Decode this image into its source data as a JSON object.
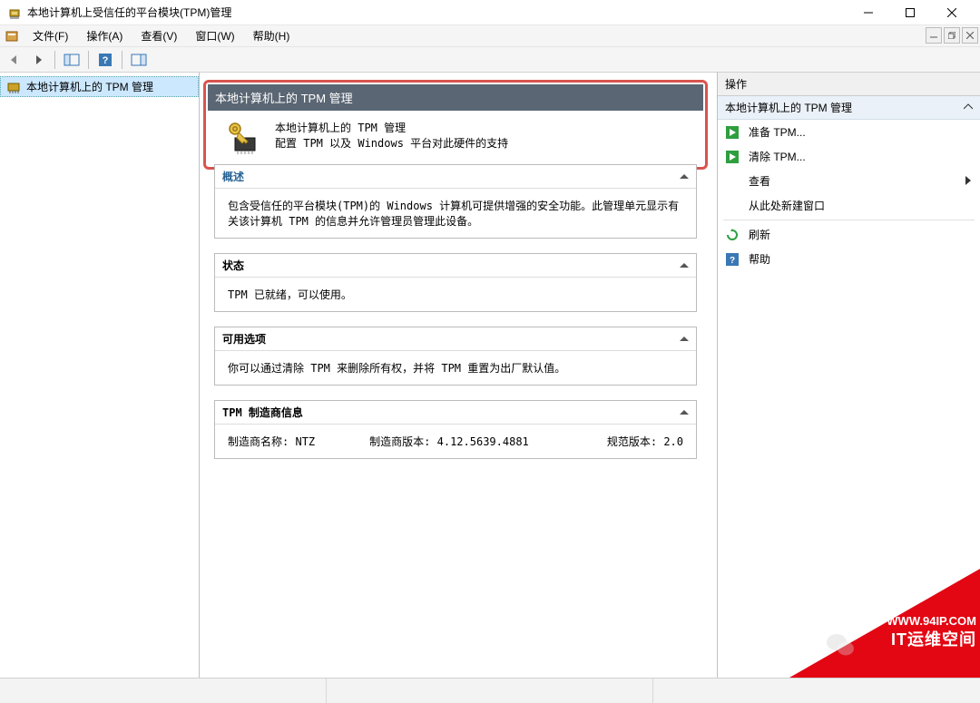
{
  "window": {
    "title": "本地计算机上受信任的平台模块(TPM)管理"
  },
  "menu": {
    "file": "文件(F)",
    "operation": "操作(A)",
    "view": "查看(V)",
    "window": "窗口(W)",
    "help": "帮助(H)"
  },
  "nav": {
    "item1": "本地计算机上的 TPM 管理"
  },
  "content": {
    "header": "本地计算机上的 TPM 管理",
    "intro_line1": "本地计算机上的 TPM 管理",
    "intro_line2": "配置 TPM 以及 Windows 平台对此硬件的支持",
    "overview_title": "概述",
    "overview_body": "包含受信任的平台模块(TPM)的 Windows 计算机可提供增强的安全功能。此管理单元显示有关该计算机 TPM 的信息并允许管理员管理此设备。",
    "status_title": "状态",
    "status_body": "TPM 已就绪，可以使用。",
    "options_title": "可用选项",
    "options_body": "你可以通过清除 TPM 来删除所有权，并将 TPM 重置为出厂默认值。",
    "mfg_title": "TPM 制造商信息",
    "mfg_name_label": "制造商名称:",
    "mfg_name_value": "NTZ",
    "mfg_ver_label": "制造商版本:",
    "mfg_ver_value": "4.12.5639.4881",
    "spec_ver_label": "规范版本:",
    "spec_ver_value": "2.0"
  },
  "actions": {
    "pane_title": "操作",
    "group_title": "本地计算机上的 TPM 管理",
    "prepare": "准备 TPM...",
    "clear": "清除 TPM...",
    "view": "查看",
    "new_window": "从此处新建窗口",
    "refresh": "刷新",
    "help": "帮助"
  },
  "watermark": {
    "url": "WWW.94IP.COM",
    "brand": "IT运维空间"
  }
}
